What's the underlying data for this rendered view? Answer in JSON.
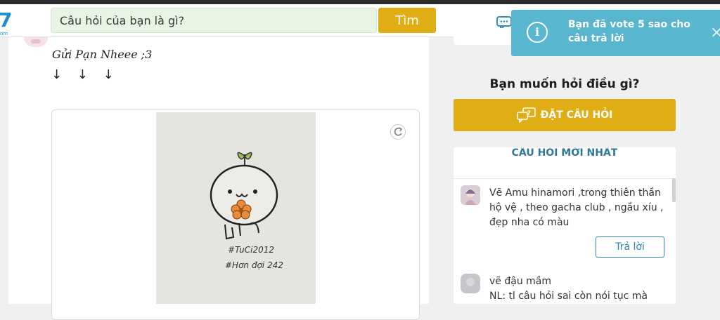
{
  "header": {
    "logo_text": "7",
    "logo_subtext": "om",
    "search_placeholder": "Câu hỏi của bạn là gì?",
    "search_button": "Tìm"
  },
  "post": {
    "text": "Gửi Pạn Nheee ;3",
    "arrows": "↓ ↓ ↓",
    "image_caption_lines": [
      "#TuCi2012",
      "#Hơn đợi 242"
    ]
  },
  "sidebar": {
    "ask_title": "Bạn muốn hỏi điều gì?",
    "ask_button": "ĐẶT CÂU HỎI",
    "latest_title": "CÂU HỎI MỚI NHẤT",
    "questions": [
      {
        "text": "Vẽ Amu hinamori ,trong thiên thần hộ vệ  , theo gacha club , ngầu xíu , đẹp nha có màu",
        "answer_button": "Trả lời"
      },
      {
        "text": "vẽ đậu mầm\nNL: tl câu hỏi sai còn nói tục mà báo"
      }
    ]
  },
  "toast": {
    "icon": "info-icon",
    "message": "Bạn đã vote 5 sao cho câu trả lời",
    "close": "×"
  },
  "colors": {
    "accent": "#e0ae14",
    "toast_bg": "#58b6ce",
    "link_blue": "#2d84ab"
  }
}
